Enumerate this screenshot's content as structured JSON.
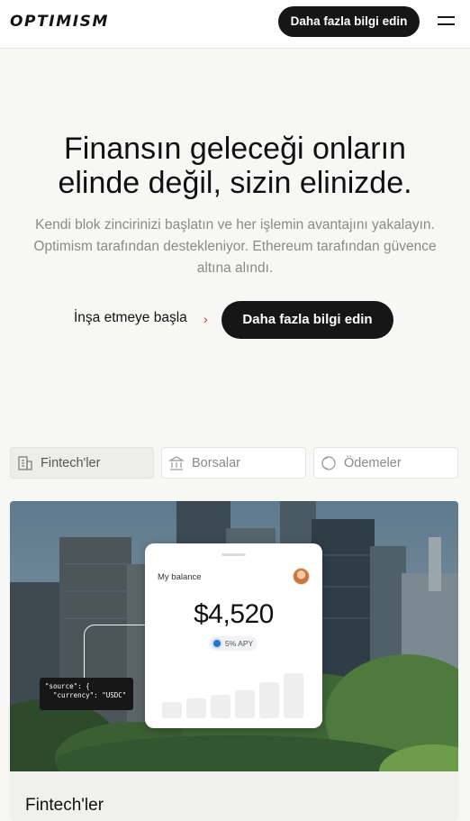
{
  "header": {
    "logo_text": "OPTIMISM",
    "cta_label": "Daha fazla bilgi edin",
    "menu_icon": "hamburger-menu-icon"
  },
  "hero": {
    "title_line1": "Finansın geleceği onların",
    "title_line2": "elinde değil, sizin elinizde.",
    "subtitle_line1": "Kendi blok zincirinizi başlatın ve her işlemin avantajını yakalayın.",
    "subtitle_line2": "Optimism tarafından destekleniyor. Ethereum tarafından güvence",
    "subtitle_line3": "altına alındı.",
    "build_link_label": "İnşa etmeye başla",
    "build_link_icon": "›",
    "cta_label": "Daha fazla bilgi edin"
  },
  "tabs": [
    {
      "label": "Fintech'ler",
      "icon": "building-icon",
      "active": true
    },
    {
      "label": "Borsalar",
      "icon": "bank-icon",
      "active": false
    },
    {
      "label": "Ödemeler",
      "icon": "coin-icon",
      "active": false
    }
  ],
  "card": {
    "title": "Fintech'ler",
    "phone": {
      "balance_label": "My balance",
      "balance_value": "$4,520",
      "apy_label": "5% APY",
      "bar_levels": [
        0.3,
        0.36,
        0.44,
        0.52,
        0.66,
        0.84
      ]
    },
    "code_lines": [
      "\"source\": {",
      "  \"currency\": \"USDC\""
    ]
  },
  "colors": {
    "page_bg": "#f7f7f5",
    "button_dark": "#161616",
    "link_chevron": "#e0312b",
    "muted_text": "#8a8a86"
  }
}
